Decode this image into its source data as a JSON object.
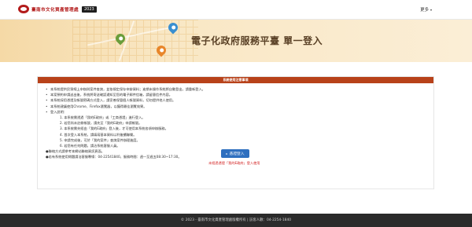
{
  "header": {
    "logo_text": "臺南市文化資產管理處",
    "year_badge": "2023",
    "more_label": "更多",
    "more_caret": "▾"
  },
  "banner": {
    "title": "電子化政府服務平臺 單一登入"
  },
  "notice": {
    "title": "系統使用注意事項",
    "items": [
      "本系統提供民眾線上申辦與案件查詢，並依規定保存申辦資料；逾期未操作系統將自動登出，請重新登入。",
      "本案預約申請送出後，系統將寄送確認通知至您的電子郵件信箱，請留意信件內容。",
      "本系統採用憑證及帳號密碼方式登入，請妥善保管個人帳號資料，切勿提供他人使用。",
      "本系統建議使用Chrome、Firefox瀏覽器，以獲得最佳瀏覽效果。",
      "登入說明："
    ],
    "steps": [
      "1. 本系統需透過「我的E政府」或「工商憑證」進行登入。",
      "2. 若您尚未註冊帳號，請先至「我的E政府」申請帳號。",
      "3. 本系統需先經由「我的E政府」登入後，才可使用本系統各項申辦服務。",
      "4. 首次登入本系統，請填寫基本資料以利後續聯繫。",
      "5. 申請完成後，可於「我的案件」查詢案件辦理進度。",
      "6. 若您有任何問題，請洽系統客服人員。"
    ],
    "contact_1": "●聯絡方式請參考本網站聯絡資訊頁面。",
    "contact_2": "●若有系統使用問題請洽客服專線：04-22541840，服務時間：週一至週五08:30~17:30。",
    "login_button": "憑證登入",
    "login_icon": "▸",
    "unregistered_link": "未經過憑證「我的E政府」登入使用"
  },
  "footer": {
    "text": "© 2023 - 臺南市文化資產管理處版權所有 | 訪客人數：04-2254-1840"
  },
  "colors": {
    "accent": "#b8421a",
    "button": "#2e6fbf",
    "footer": "#2b2b2b"
  }
}
